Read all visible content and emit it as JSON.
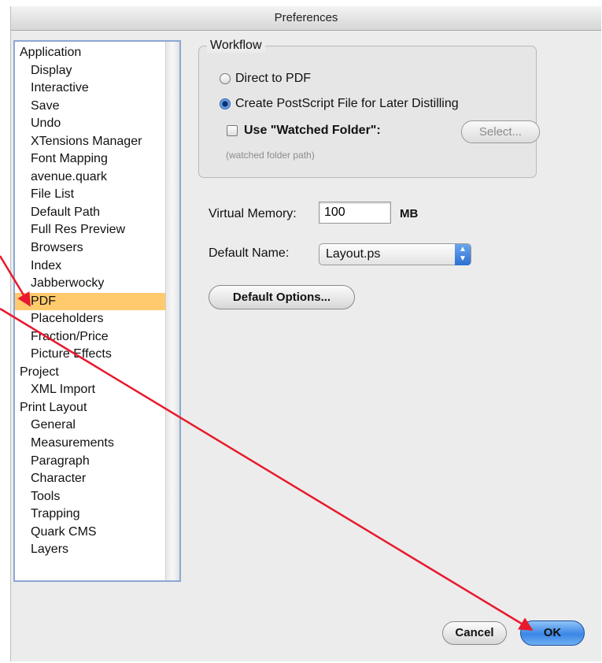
{
  "window": {
    "title": "Preferences"
  },
  "sidebar": {
    "items": [
      {
        "label": "Application",
        "level": 0
      },
      {
        "label": "Display",
        "level": 1
      },
      {
        "label": "Interactive",
        "level": 1
      },
      {
        "label": "Save",
        "level": 1
      },
      {
        "label": "Undo",
        "level": 1
      },
      {
        "label": "XTensions Manager",
        "level": 1
      },
      {
        "label": "Font Mapping",
        "level": 1
      },
      {
        "label": "avenue.quark",
        "level": 1
      },
      {
        "label": "File List",
        "level": 1
      },
      {
        "label": "Default Path",
        "level": 1
      },
      {
        "label": "Full Res Preview",
        "level": 1
      },
      {
        "label": "Browsers",
        "level": 1
      },
      {
        "label": "Index",
        "level": 1
      },
      {
        "label": "Jabberwocky",
        "level": 1
      },
      {
        "label": "PDF",
        "level": 1,
        "selected": true
      },
      {
        "label": "Placeholders",
        "level": 1
      },
      {
        "label": "Fraction/Price",
        "level": 1
      },
      {
        "label": "Picture Effects",
        "level": 1
      },
      {
        "label": "Project",
        "level": 0
      },
      {
        "label": "XML Import",
        "level": 1
      },
      {
        "label": "Print Layout",
        "level": 0
      },
      {
        "label": "General",
        "level": 1
      },
      {
        "label": "Measurements",
        "level": 1
      },
      {
        "label": "Paragraph",
        "level": 1
      },
      {
        "label": "Character",
        "level": 1
      },
      {
        "label": "Tools",
        "level": 1
      },
      {
        "label": "Trapping",
        "level": 1
      },
      {
        "label": "Quark CMS",
        "level": 1
      },
      {
        "label": "Layers",
        "level": 1
      }
    ]
  },
  "workflow": {
    "legend": "Workflow",
    "direct_to_pdf": "Direct to PDF",
    "create_postscript": "Create PostScript File for Later Distilling",
    "selected_option": "create_postscript",
    "use_watched_folder": "Use \"Watched Folder\":",
    "watched_folder_checked": false,
    "select_button": "Select...",
    "watched_folder_path": "(watched folder path)"
  },
  "virtual_memory": {
    "label": "Virtual Memory:",
    "value": "100",
    "unit": "MB"
  },
  "default_name": {
    "label": "Default Name:",
    "value": "Layout.ps"
  },
  "default_options_button": "Default Options...",
  "footer": {
    "cancel": "Cancel",
    "ok": "OK"
  },
  "colors": {
    "selection": "#ffca6e",
    "annotation_arrow": "#e8192c",
    "default_button": "#3b86e6"
  }
}
